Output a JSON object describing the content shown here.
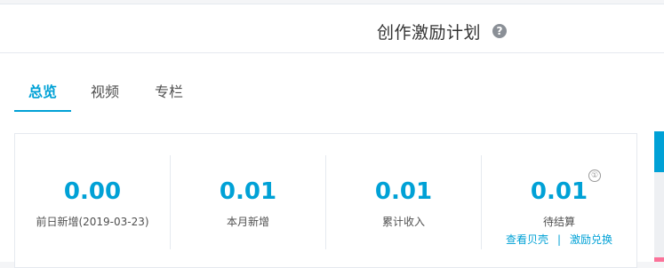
{
  "header": {
    "title": "创作激励计划",
    "help_icon": "?"
  },
  "tabs": [
    {
      "label": "总览"
    },
    {
      "label": "视频"
    },
    {
      "label": "专栏"
    }
  ],
  "stats": [
    {
      "value": "0.00",
      "label": "前日新增(2019-03-23)"
    },
    {
      "value": "0.01",
      "label": "本月新增"
    },
    {
      "value": "0.01",
      "label": "累计收入"
    },
    {
      "value": "0.01",
      "label": "待结算",
      "info_icon": "①",
      "links": [
        "查看贝壳",
        "|",
        "激励兑换"
      ]
    }
  ],
  "colors": {
    "accent": "#00a1d6",
    "pink": "#fb7299"
  }
}
